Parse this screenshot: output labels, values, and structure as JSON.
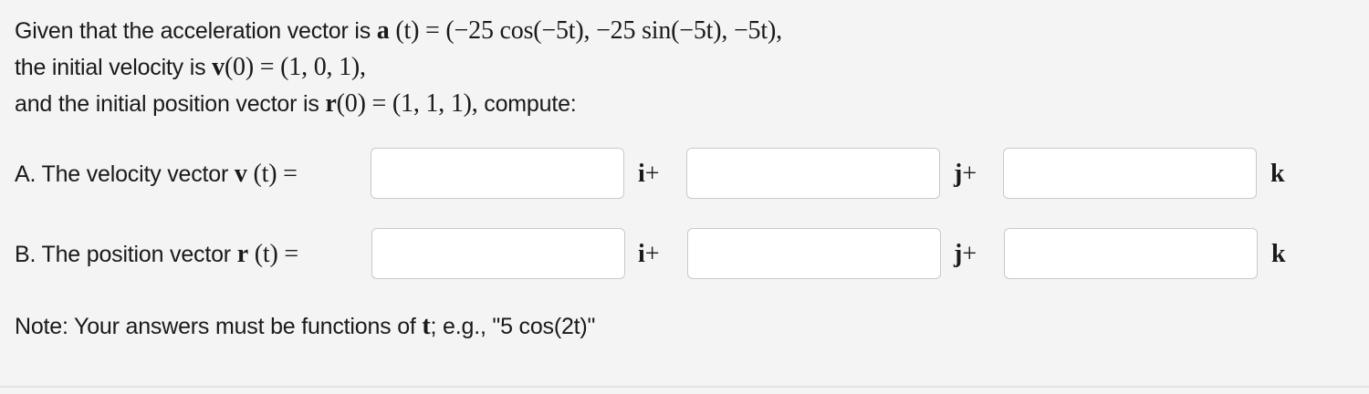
{
  "problem": {
    "line1_text": "Given that the acceleration vector is ",
    "line1_vec": "a",
    "line1_math": "(t) = (−25 cos(−5t), −25 sin(−5t), −5t),",
    "line2_text": "the initial velocity is ",
    "line2_vec": "v",
    "line2_math": "(0) = (1, 0, 1),",
    "line3_text": "and the initial position vector is ",
    "line3_vec": "r",
    "line3_math": "(0) = (1, 1, 1),",
    "line3_suffix": " compute:"
  },
  "part_a": {
    "label_text": "A. The velocity vector ",
    "label_vec": "v",
    "label_math": "(t) =",
    "i_unit": "i",
    "j_unit": "j",
    "k_unit": "k",
    "plus": "+",
    "i_value": "",
    "j_value": "",
    "k_value": ""
  },
  "part_b": {
    "label_text": "B. The position vector ",
    "label_vec": "r",
    "label_math": "(t) =",
    "i_unit": "i",
    "j_unit": "j",
    "k_unit": "k",
    "plus": "+",
    "i_value": "",
    "j_value": "",
    "k_value": ""
  },
  "note": {
    "prefix": "Note: Your answers must be functions of ",
    "var": "t",
    "suffix": "; e.g., \"5 cos(2t)\""
  }
}
